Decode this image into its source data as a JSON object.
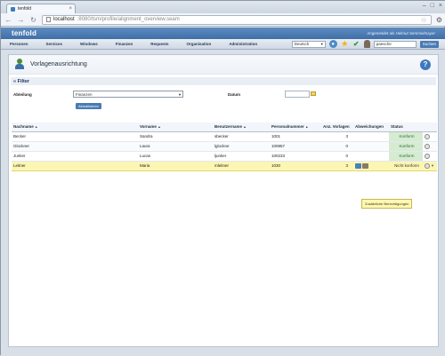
{
  "browser": {
    "tab_title": "tenfold",
    "url_host": "localhost",
    "url_path": ":8080/tsm/profile/alignment_overview.seam"
  },
  "header": {
    "brand": "tenfold",
    "login_info": "Angemeldet als Helmut Semmelmayer"
  },
  "menu": {
    "items": [
      "Personen",
      "Services",
      "Windows",
      "Finanzen",
      "Requests",
      "Organisation",
      "Administration"
    ],
    "language": "Deutsch",
    "search_value": "paesche",
    "search_button": "Suchen"
  },
  "page": {
    "title": "Vorlagenausrichtung"
  },
  "filter": {
    "heading": "« Filter",
    "department_label": "Abteilung",
    "department_value": "Finanzen",
    "date_label": "Datum",
    "refresh_button": "Aktualisieren"
  },
  "table": {
    "headers": [
      "Nachname",
      "Vorname",
      "Benutzername",
      "Personalnummer",
      "Anz. Vorlagen",
      "Abweichungen",
      "Status"
    ],
    "rows": [
      {
        "last": "Becker",
        "first": "Sandra",
        "user": "sbecker",
        "id": "1001",
        "count": "3",
        "status": "Konform"
      },
      {
        "last": "Glockner",
        "first": "Laura",
        "user": "lglockne",
        "id": "100857",
        "count": "0",
        "status": "Konform"
      },
      {
        "last": "Junker",
        "first": "Lucas",
        "user": "ljunker",
        "id": "100233",
        "count": "0",
        "status": "Konform"
      },
      {
        "last": "Leitner",
        "first": "Maria",
        "user": "mleitner",
        "id": "1030",
        "count": "3",
        "status": "Nicht konform"
      }
    ]
  },
  "tooltip": {
    "text": "Zusätzliche Berechtigungen"
  },
  "colors": {
    "brand": "#3f6fa8",
    "ok": "#d6ecd2",
    "highlight": "#fbf6b4"
  }
}
